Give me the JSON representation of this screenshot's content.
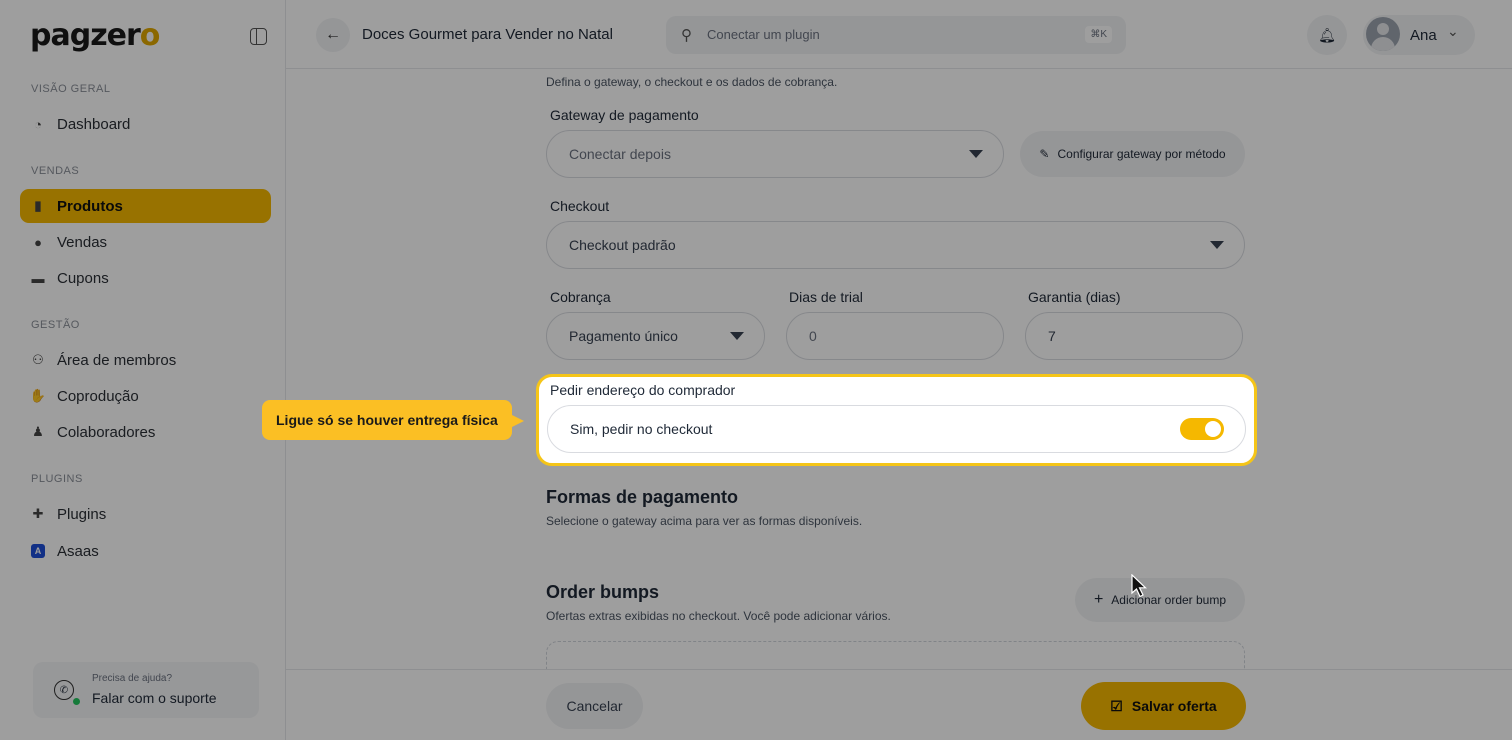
{
  "sidebar": {
    "logo_main": "pagzer",
    "logo_accent": "o",
    "sections": {
      "overview": "VISÃO GERAL",
      "sales": "VENDAS",
      "management": "GESTÃO",
      "plugins": "PLUGINS"
    },
    "items": {
      "dashboard": "Dashboard",
      "products": "Produtos",
      "sales": "Vendas",
      "coupons": "Cupons",
      "members": "Área de membros",
      "coproduction": "Coprodução",
      "collaborators": "Colaboradores",
      "plugins": "Plugins",
      "asaas": "Asaas"
    },
    "support": {
      "question": "Precisa de ajuda?",
      "link": "Falar com o suporte"
    }
  },
  "header": {
    "title": "Doces Gourmet para Vender no Natal",
    "search_placeholder": "Conectar um plugin",
    "search_shortcut": "⌘K",
    "user_name": "Ana"
  },
  "form": {
    "section_desc": "Defina o gateway, o checkout e os dados de cobrança.",
    "gateway_label": "Gateway de pagamento",
    "gateway_value": "Conectar depois",
    "gateway_config_button": "Configurar gateway por método",
    "checkout_label": "Checkout",
    "checkout_value": "Checkout padrão",
    "billing_label": "Cobrança",
    "billing_value": "Pagamento único",
    "trial_label": "Dias de trial",
    "trial_value": "0",
    "warranty_label": "Garantia (dias)",
    "warranty_value": "7",
    "address_label": "Pedir endereço do comprador",
    "address_toggle_text": "Sim, pedir no checkout",
    "address_toggle_on": true,
    "payment_methods_title": "Formas de pagamento",
    "payment_methods_desc": "Selecione o gateway acima para ver as formas disponíveis.",
    "order_bumps_title": "Order bumps",
    "order_bumps_desc": "Ofertas extras exibidas no checkout. Você pode adicionar vários.",
    "add_order_bump_button": "Adicionar order bump"
  },
  "footer": {
    "cancel": "Cancelar",
    "save": "Salvar oferta"
  },
  "tooltip": {
    "text": "Ligue só se houver entrega física"
  },
  "colors": {
    "accent": "#f5b800",
    "highlight_border": "#f5c518"
  }
}
